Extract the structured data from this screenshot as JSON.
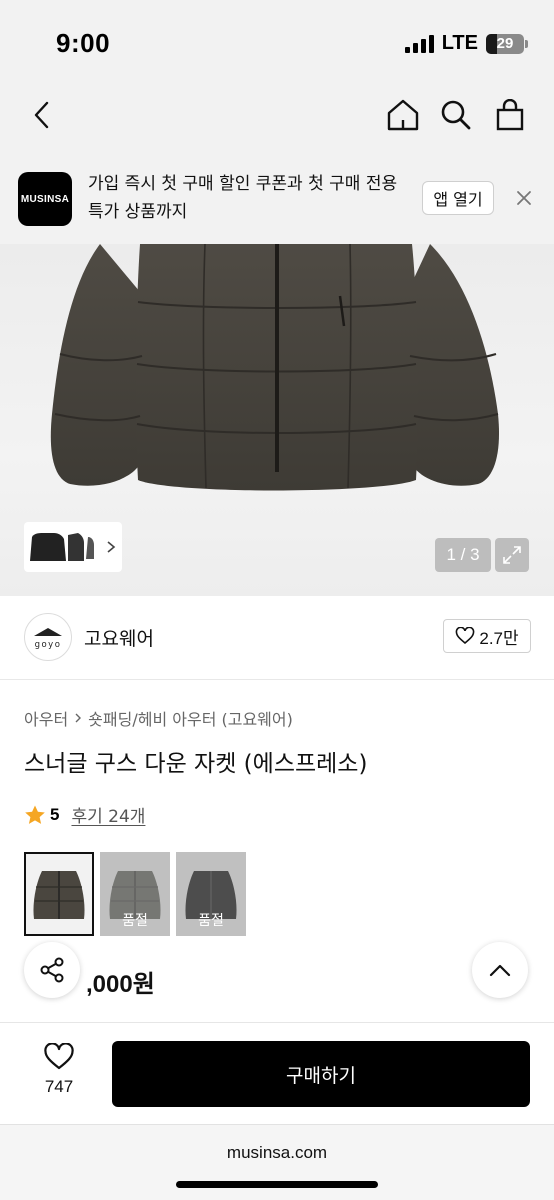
{
  "status_bar": {
    "time": "9:00",
    "network": "LTE",
    "battery": "29",
    "battery_level": 0.29
  },
  "nav": {
    "icons": [
      "chevron-left-icon",
      "home-icon",
      "search-icon",
      "shopping-bag-icon"
    ]
  },
  "promo": {
    "logo_text": "MUSINSA",
    "text": "가입 즉시 첫 구매 할인 쿠폰과 첫 구매 전용 특가 상품까지",
    "open_button": "앱 열기"
  },
  "gallery": {
    "counter": "1 / 3",
    "jacket_color": "#4a463f"
  },
  "brand": {
    "name": "고요웨어",
    "logo_text": "goyo",
    "likes": "2.7만"
  },
  "breadcrumb": {
    "category": "아우터",
    "subcategory": "숏패딩/헤비 아우터 (고요웨어)"
  },
  "product": {
    "title": "스너글 구스 다운 자켓 (에스프레소)",
    "rating": "5",
    "reviews": "후기 24개",
    "price_visible": ",000원"
  },
  "variants": [
    {
      "color": "#4a463f",
      "selected": true,
      "soldout": ""
    },
    {
      "color": "#5c5e57",
      "selected": false,
      "soldout": "품절"
    },
    {
      "color": "#111111",
      "selected": false,
      "soldout": "품절"
    }
  ],
  "bottom_bar": {
    "wish_count": "747",
    "buy_label": "구매하기"
  },
  "browser": {
    "url": "musinsa.com"
  },
  "colors": {
    "star": "#f5a623",
    "primary": "#000000"
  }
}
